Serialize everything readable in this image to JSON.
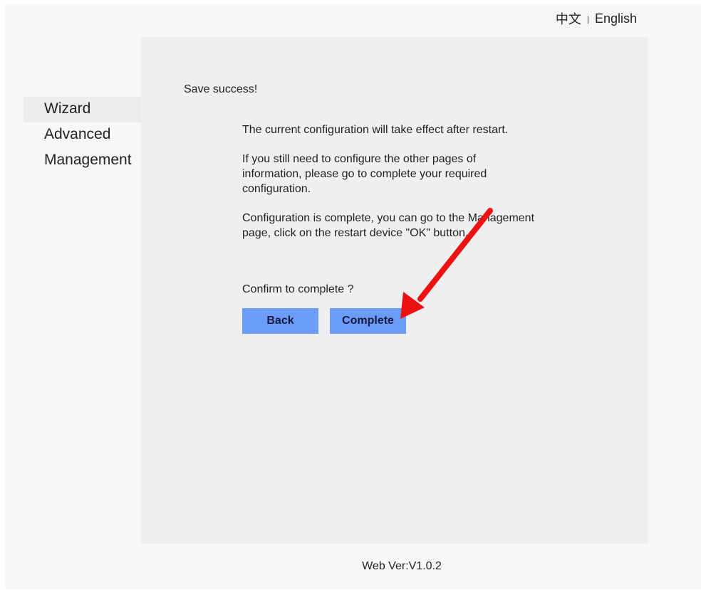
{
  "language": {
    "chinese": "中文",
    "separator": "|",
    "english": "English"
  },
  "sidebar": {
    "items": [
      {
        "label": "Wizard",
        "active": true
      },
      {
        "label": "Advanced",
        "active": false
      },
      {
        "label": "Management",
        "active": false
      }
    ]
  },
  "content": {
    "save_message": "Save success!",
    "restart_note": "The current configuration will take effect after restart.",
    "other_pages_note": "If you still need to configure the other pages of information,  please go to complete your required configuration.",
    "complete_note": "Configuration is complete,  you can go to the Management page,  click on the restart device \"OK\" button.",
    "confirm_question": "Confirm to complete ?"
  },
  "buttons": {
    "back_label": "Back",
    "complete_label": "Complete"
  },
  "footer": {
    "version": "Web Ver:V1.0.2"
  },
  "colors": {
    "button_bg": "#6b9cf7",
    "annotation_arrow": "#ee1111"
  }
}
